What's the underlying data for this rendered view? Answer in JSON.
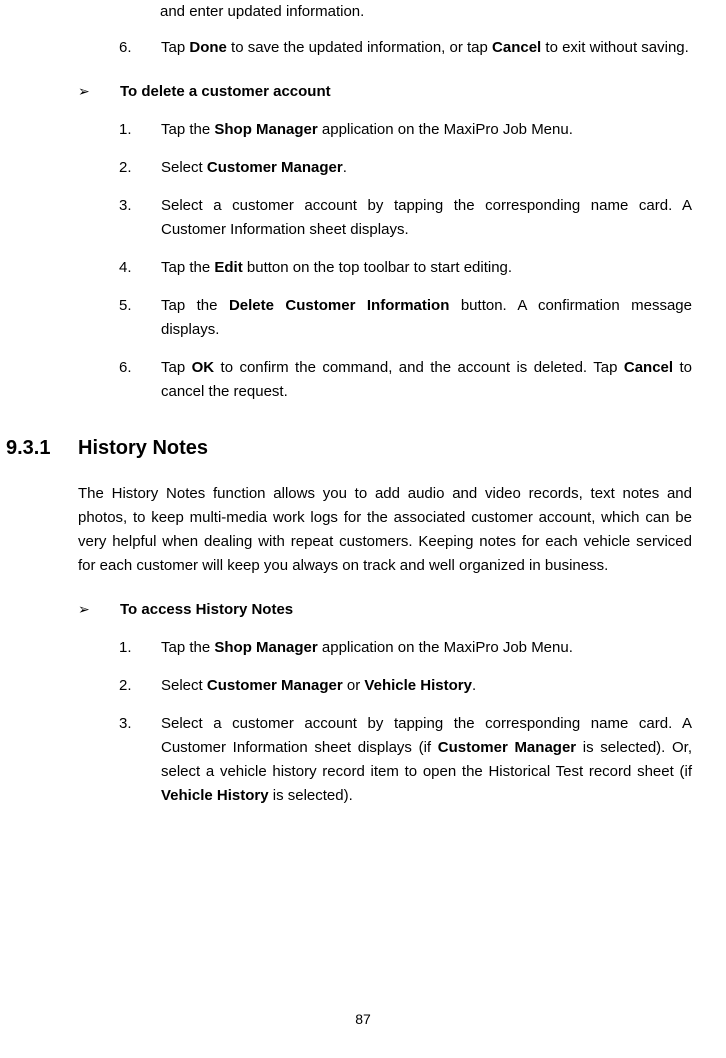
{
  "truncatedTop": "and enter updated information.",
  "topItem": {
    "num": "6.",
    "parts": [
      {
        "t": "Tap ",
        "b": false
      },
      {
        "t": "Done",
        "b": true
      },
      {
        "t": " to save the updated information, or tap ",
        "b": false
      },
      {
        "t": "Cancel",
        "b": true
      },
      {
        "t": " to exit without saving.",
        "b": false
      }
    ]
  },
  "deleteHeader": "To delete a customer account",
  "deleteSteps": [
    {
      "num": "1.",
      "parts": [
        {
          "t": "Tap the ",
          "b": false
        },
        {
          "t": "Shop Manager",
          "b": true
        },
        {
          "t": " application on the MaxiPro Job Menu.",
          "b": false
        }
      ]
    },
    {
      "num": "2.",
      "parts": [
        {
          "t": "Select ",
          "b": false
        },
        {
          "t": "Customer Manager",
          "b": true
        },
        {
          "t": ".",
          "b": false
        }
      ]
    },
    {
      "num": "3.",
      "parts": [
        {
          "t": "Select a customer account by tapping the corresponding name card. A Customer Information sheet displays.",
          "b": false
        }
      ]
    },
    {
      "num": "4.",
      "parts": [
        {
          "t": "Tap the ",
          "b": false
        },
        {
          "t": "Edit",
          "b": true
        },
        {
          "t": " button on the top toolbar to start editing.",
          "b": false
        }
      ]
    },
    {
      "num": "5.",
      "parts": [
        {
          "t": "Tap the ",
          "b": false
        },
        {
          "t": "Delete Customer Information",
          "b": true
        },
        {
          "t": " button. A confirmation message displays.",
          "b": false
        }
      ]
    },
    {
      "num": "6.",
      "parts": [
        {
          "t": "Tap ",
          "b": false
        },
        {
          "t": "OK",
          "b": true
        },
        {
          "t": " to confirm the command, and the account is deleted. Tap ",
          "b": false
        },
        {
          "t": "Cancel",
          "b": true
        },
        {
          "t": " to cancel the request.",
          "b": false
        }
      ]
    }
  ],
  "sectionNum": "9.3.1",
  "sectionTitle": "History Notes",
  "historyPara": "The History Notes function allows you to add audio and video records, text notes and photos, to keep multi-media work logs for the associated customer account, which can be very helpful when dealing with repeat customers. Keeping notes for each vehicle serviced for each customer will keep you always on track and well organized in business.",
  "accessHeader": "To access History Notes",
  "accessSteps": [
    {
      "num": "1.",
      "parts": [
        {
          "t": "Tap the ",
          "b": false
        },
        {
          "t": "Shop Manager",
          "b": true
        },
        {
          "t": " application on the MaxiPro Job Menu.",
          "b": false
        }
      ]
    },
    {
      "num": "2.",
      "parts": [
        {
          "t": "Select ",
          "b": false
        },
        {
          "t": "Customer Manager",
          "b": true
        },
        {
          "t": " or ",
          "b": false
        },
        {
          "t": "Vehicle History",
          "b": true
        },
        {
          "t": ".",
          "b": false
        }
      ]
    },
    {
      "num": "3.",
      "parts": [
        {
          "t": "Select a customer account by tapping the corresponding name card. A Customer Information sheet displays (if ",
          "b": false
        },
        {
          "t": "Customer Manager",
          "b": true
        },
        {
          "t": " is selected). Or, select a vehicle history record item to open the Historical Test record sheet (if ",
          "b": false
        },
        {
          "t": "Vehicle History",
          "b": true
        },
        {
          "t": " is selected).",
          "b": false
        }
      ]
    }
  ],
  "pageNum": "87",
  "arrowGlyph": "➢"
}
